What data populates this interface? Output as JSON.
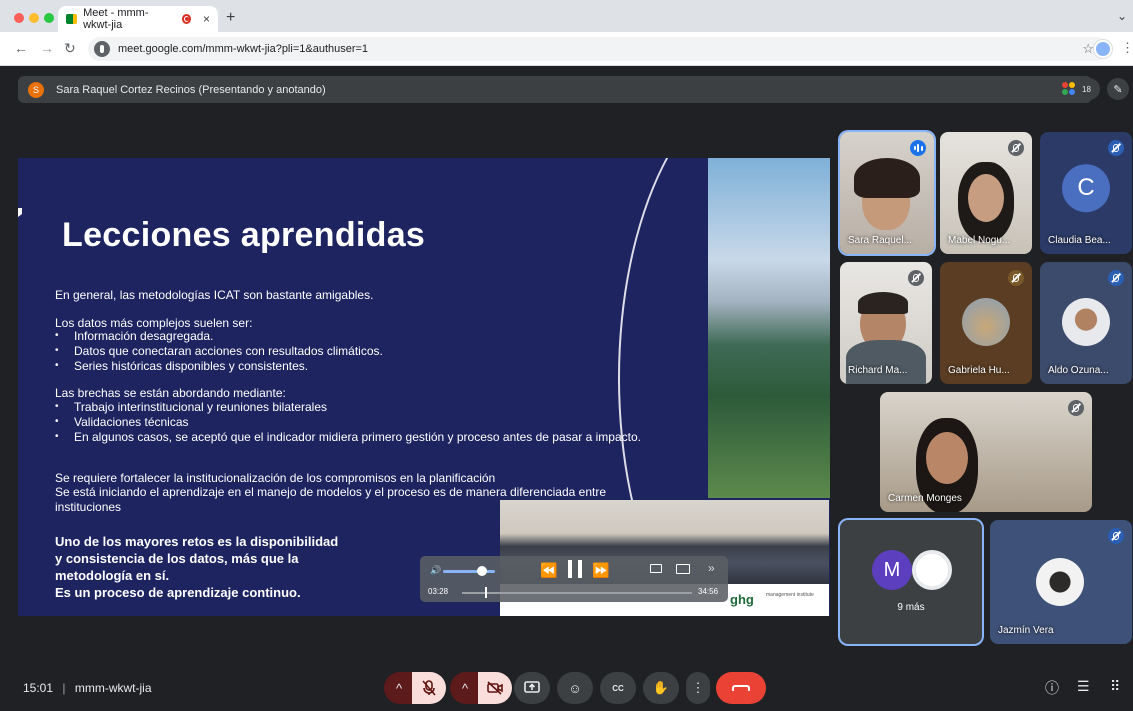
{
  "browser": {
    "tab_title": "Meet - mmm-wkwt-jia",
    "tab_close": "×",
    "new_tab": "+",
    "tab_menu": "⌄",
    "url": "meet.google.com/mmm-wkwt-jia?pli=1&authuser=1",
    "icons": {
      "back": "←",
      "forward": "→",
      "reload": "↻",
      "star": "☆",
      "menu": "⋮"
    }
  },
  "meeting": {
    "presenter_initial": "S",
    "presenter_bar": "Sara Raquel Cortez Recinos (Presentando y anotando)",
    "participant_count": "18",
    "time": "15:01",
    "separator": "|",
    "code": "mmm-wkwt-jia"
  },
  "slide": {
    "title": "Lecciones aprendidas",
    "p1": "En general, las metodologías ICAT son bastante amigables.",
    "p2": "Los datos más complejos suelen ser:",
    "list1": [
      "Información desagregada.",
      "Datos que conectaran acciones con resultados climáticos.",
      "Series históricas disponibles y consistentes."
    ],
    "p3": "Las brechas se están abordando mediante:",
    "list2": [
      "Trabajo interinstitucional y reuniones bilaterales",
      "Validaciones técnicas",
      "En algunos casos, se aceptó que el indicador midiera primero gestión y proceso antes de pasar a impacto."
    ],
    "p4": "Se requiere fortalecer la institucionalización de los compromisos en la planificación",
    "p5": "Se está iniciando el aprendizaje en el manejo de modelos y el proceso es de manera diferenciada entre instituciones",
    "highlight": [
      "Uno de los mayores retos es la disponibilidad",
      "y consistencia de los datos, más que la",
      "metodología en sí.",
      "Es un proceso de aprendizaje continuo."
    ]
  },
  "video": {
    "logo": "ghg",
    "logo_sub": "management institute",
    "current_time": "03:28",
    "duration": "34:56",
    "progress": 0.099,
    "volume": 0.75,
    "icons": {
      "volume": "🔊",
      "rewind": "⏪",
      "forward": "⏩",
      "more": "»"
    }
  },
  "participants": [
    {
      "name": "Sara Raquel...",
      "state": "speaking"
    },
    {
      "name": "Mabel Nogu...",
      "state": "muted"
    },
    {
      "name": "Claudia Bea...",
      "state": "muted",
      "initial": "C"
    },
    {
      "name": "Richard Ma...",
      "state": "muted"
    },
    {
      "name": "Gabriela Hu...",
      "state": "muted"
    },
    {
      "name": "Aldo Ozuna...",
      "state": "muted"
    },
    {
      "name": "Carmen Monges",
      "state": "muted"
    },
    {
      "name": "9 más",
      "initial": "M"
    },
    {
      "name": "Jazmín Vera",
      "state": "muted"
    }
  ],
  "controls": {
    "expand": "^",
    "present": "⬆",
    "emoji": "☺",
    "cc": "CC",
    "raise_hand": "✋",
    "more": "⋮",
    "info": "ⓘ",
    "chat": "☰",
    "activities": "⠿",
    "edit": "✎"
  },
  "colors": {
    "accent": "#8ab4f8",
    "leave": "#ea4335",
    "slide_bg": "#1d2460",
    "speaking": "#1a73e8"
  }
}
